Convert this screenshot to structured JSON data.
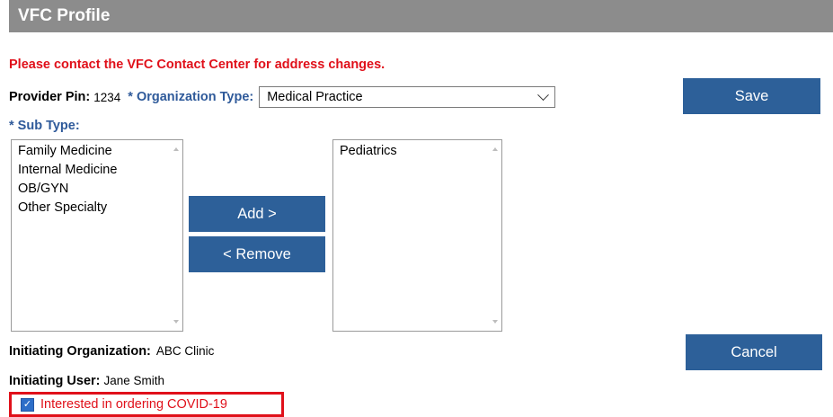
{
  "header": {
    "title": "VFC Profile"
  },
  "notice": "Please contact the VFC Contact Center for address changes.",
  "provider": {
    "pin_label": "Provider Pin:",
    "pin_value": "1234"
  },
  "org_type": {
    "label": "* Organization Type:",
    "selected": "Medical Practice"
  },
  "sub_type": {
    "label": "* Sub Type:",
    "available": [
      "Family Medicine",
      "Internal Medicine",
      "OB/GYN",
      "Other Specialty"
    ],
    "selected": [
      "Pediatrics"
    ]
  },
  "buttons": {
    "save": "Save",
    "add": "Add >",
    "remove": "< Remove",
    "cancel": "Cancel"
  },
  "initiating": {
    "org_label": "Initiating Organization:",
    "org_value": "ABC Clinic",
    "user_label": "Initiating User:",
    "user_value": "Jane Smith"
  },
  "covid": {
    "label": "Interested in ordering COVID-19",
    "checked": true,
    "check_mark": "✓"
  },
  "colors": {
    "header_bg": "#8c8c8c",
    "button_bg": "#2d6099",
    "alert_red": "#e0101a",
    "label_blue": "#2f5a9a"
  }
}
